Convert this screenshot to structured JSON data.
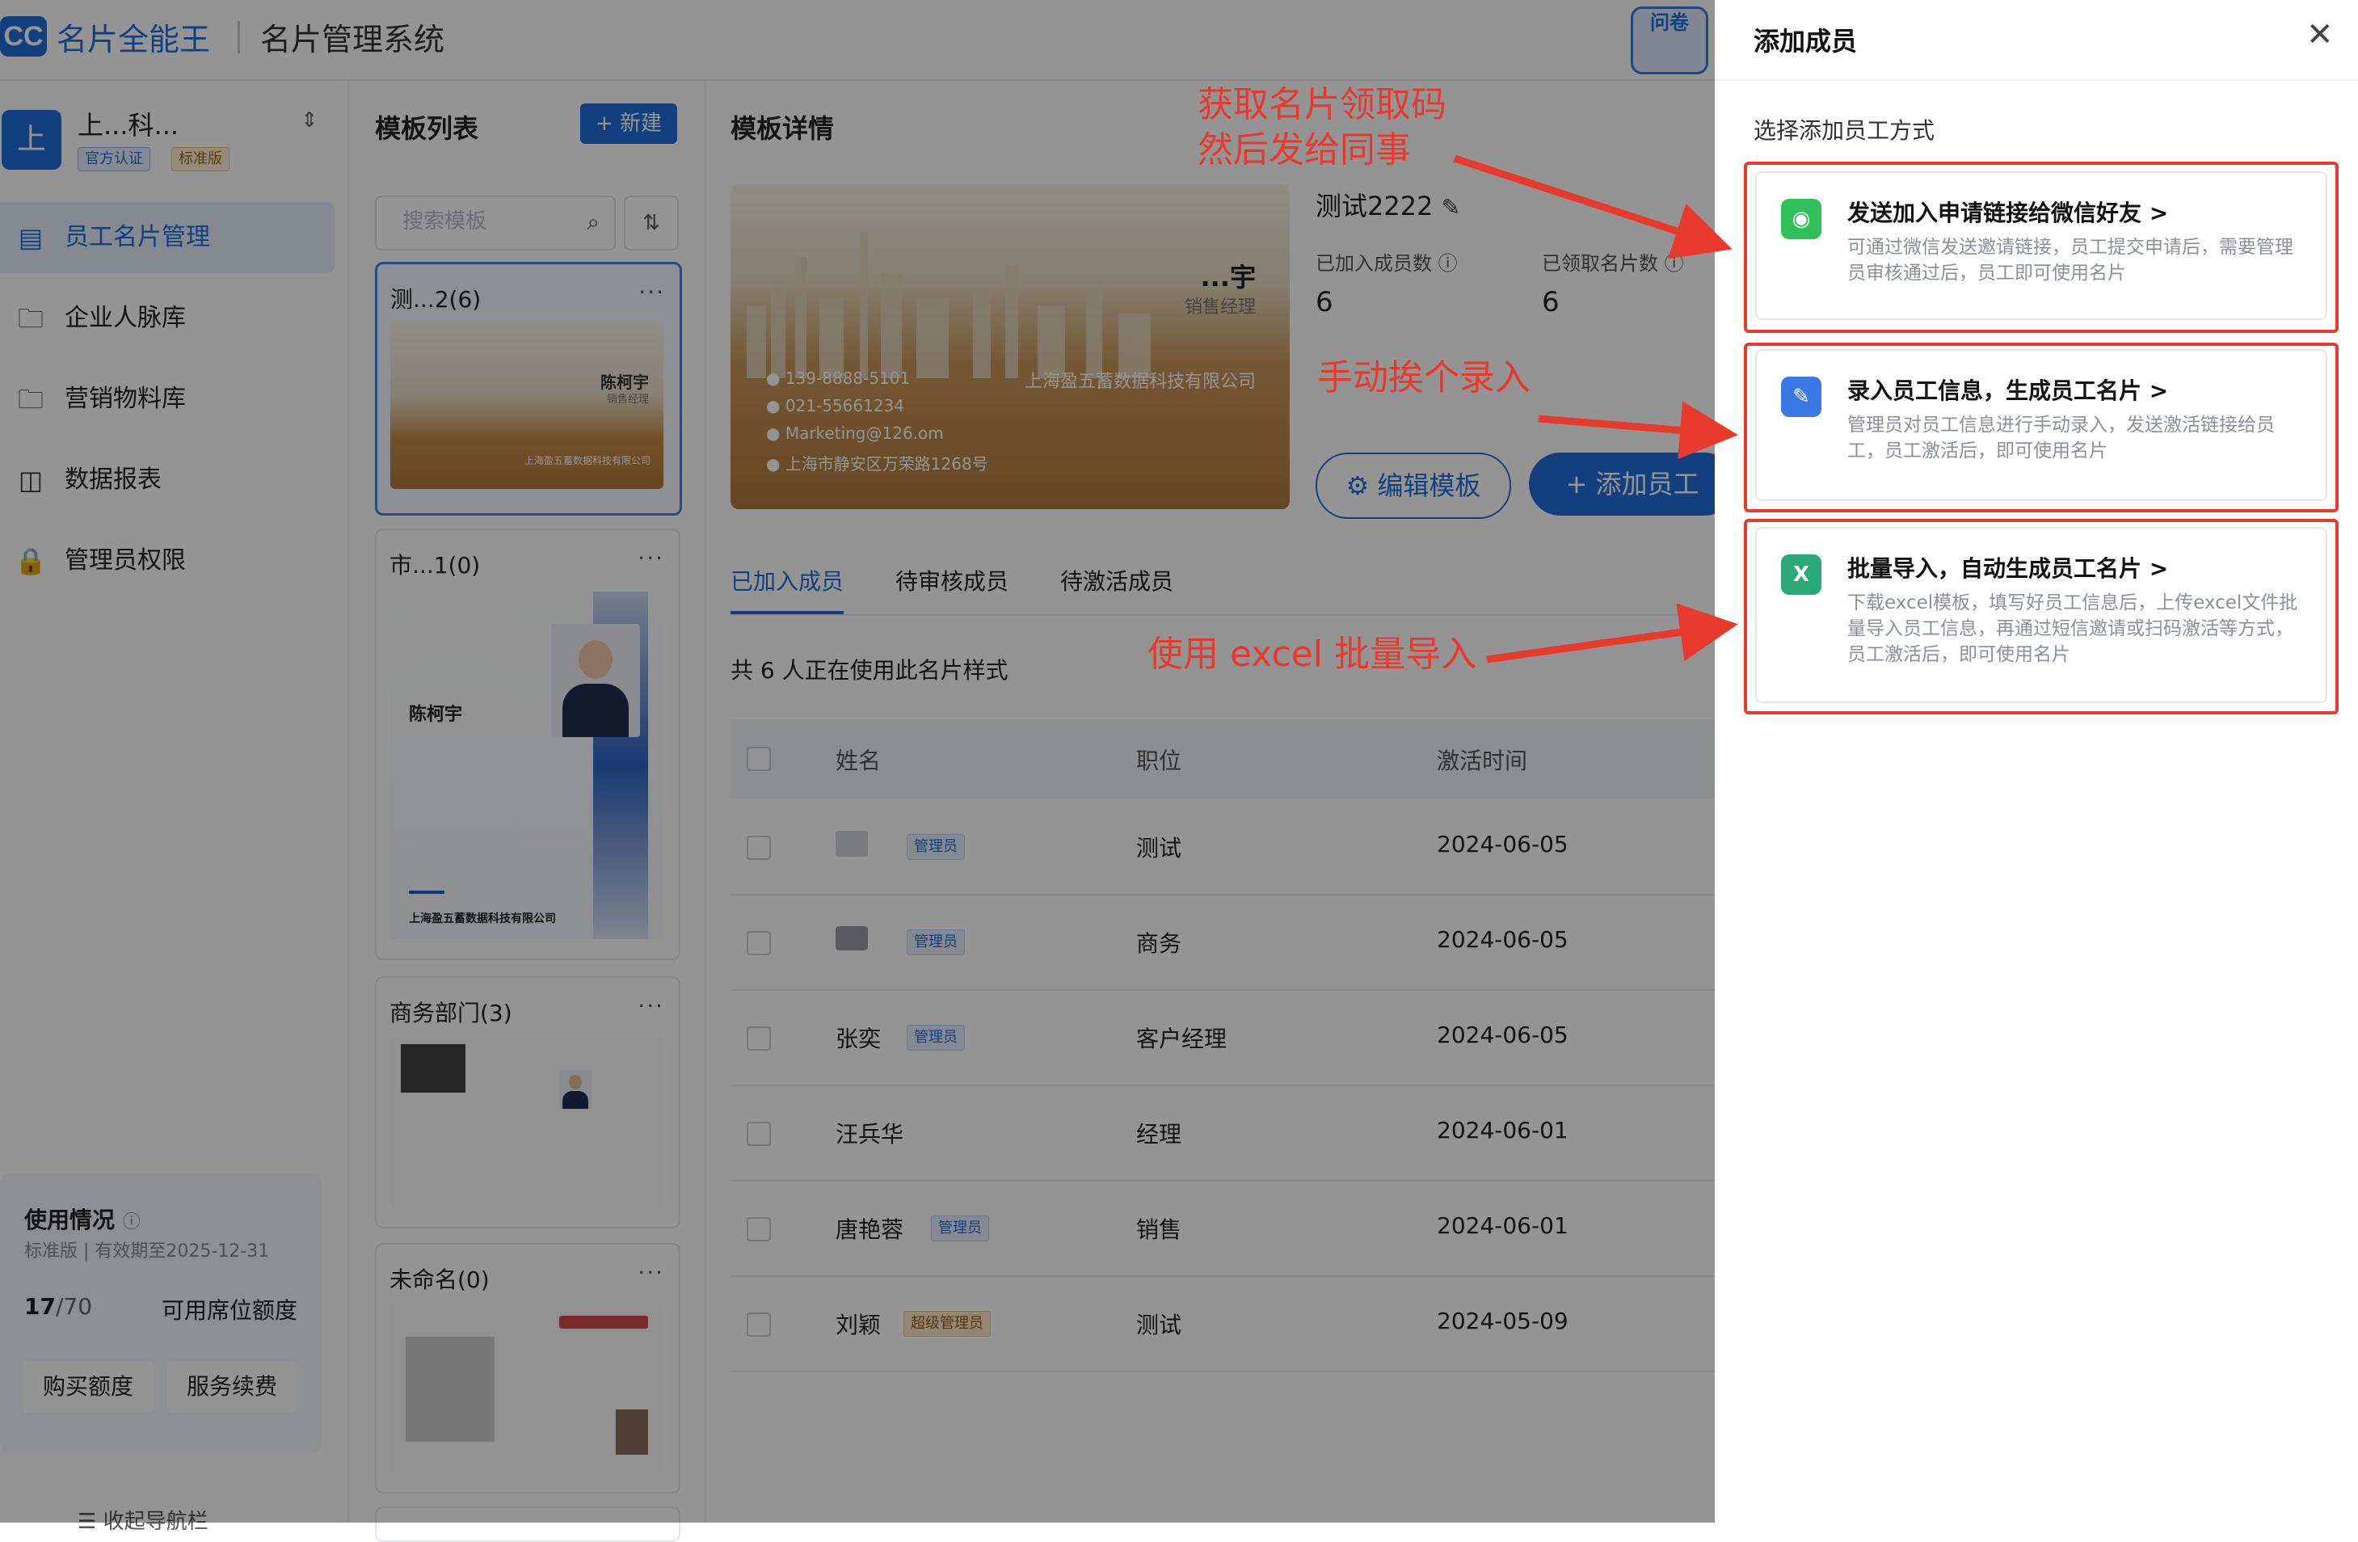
{
  "header": {
    "logo_mark": "CC",
    "brand": "名片全能王",
    "system_title": "名片管理系统",
    "survey_label": "问卷"
  },
  "sidebar": {
    "company_avatar": "上",
    "company_name": "上...科...",
    "badge_official": "官方认证",
    "badge_standard": "标准版",
    "nav": [
      {
        "label": "员工名片管理",
        "icon": "id-card-icon"
      },
      {
        "label": "企业人脉库",
        "icon": "contacts-folder-icon"
      },
      {
        "label": "营销物料库",
        "icon": "folder-icon"
      },
      {
        "label": "数据报表",
        "icon": "chart-icon"
      },
      {
        "label": "管理员权限",
        "icon": "lock-icon"
      }
    ],
    "usage": {
      "title": "使用情况",
      "subtitle": "标准版 | 有效期至2025-12-31",
      "used": "17",
      "total": "/70",
      "label": "可用席位额度",
      "buy": "购买额度",
      "renew": "服务续费"
    },
    "collapse": "收起导航栏"
  },
  "templates": {
    "title": "模板列表",
    "new_label": "+ 新建",
    "search_placeholder": "搜索模板",
    "items": [
      {
        "name": "测...2(6)",
        "person": "陈柯宇",
        "role": "销售经理",
        "company": "上海盈五蓄数据科技有限公司"
      },
      {
        "name": "市...1(0)",
        "person": "陈柯宇",
        "company": "上海盈五蓄数据科技有限公司"
      },
      {
        "name": "商务部门(3)"
      },
      {
        "name": "未命名(0)"
      }
    ]
  },
  "detail": {
    "title": "模板详情",
    "card": {
      "name": "...宇",
      "role": "销售经理",
      "company": "上海盈五蓄数据科技有限公司",
      "phone": "139-8888-5101",
      "tel": "021-55661234",
      "email": "Marketing@126.om",
      "address": "上海市静安区万荣路1268号"
    },
    "template_name": "测试2222",
    "joined_label": "已加入成员数",
    "joined_value": "6",
    "claimed_label": "已领取名片数",
    "claimed_value": "6",
    "edit_btn": "编辑模板",
    "add_btn": "+ 添加员工",
    "tabs": [
      "已加入成员",
      "待审核成员",
      "待激活成员"
    ],
    "summary": "共 6 人正在使用此名片样式",
    "columns": [
      "姓名",
      "职位",
      "激活时间"
    ],
    "rows": [
      {
        "name": "",
        "role_badge": "管理员",
        "title": "测试",
        "date": "2024-06-05"
      },
      {
        "name": "",
        "role_badge": "管理员",
        "title": "商务",
        "date": "2024-06-05"
      },
      {
        "name": "张奕",
        "role_badge": "管理员",
        "title": "客户经理",
        "date": "2024-06-05"
      },
      {
        "name": "汪兵华",
        "role_badge": "",
        "title": "经理",
        "date": "2024-06-01"
      },
      {
        "name": "唐艳蓉",
        "role_badge": "管理员",
        "title": "销售",
        "date": "2024-06-01"
      },
      {
        "name": "刘颖",
        "role_badge": "超级管理员",
        "title": "测试",
        "date": "2024-05-09"
      }
    ]
  },
  "drawer": {
    "title": "添加成员",
    "subtitle": "选择添加员工方式",
    "options": [
      {
        "title": "发送加入申请链接给微信好友 >",
        "desc": "可通过微信发送邀请链接，员工提交申请后，需要管理员审核通过后，员工即可使用名片",
        "icon": "wechat-icon",
        "color": "#2fbf5b"
      },
      {
        "title": "录入员工信息，生成员工名片 >",
        "desc": "管理员对员工信息进行手动录入，发送激活链接给员工，员工激活后，即可使用名片",
        "icon": "edit-icon",
        "color": "#3a78e6"
      },
      {
        "title": "批量导入，自动生成员工名片 >",
        "desc": "下载excel模板，填写好员工信息后，上传excel文件批量导入员工信息，再通过短信邀请或扫码激活等方式，员工激活后，即可使用名片",
        "icon": "excel-icon",
        "color": "#2aa878"
      }
    ]
  },
  "annotations": {
    "a1_line1": "获取名片领取码",
    "a1_line2": "然后发给同事",
    "a2": "手动挨个录入",
    "a3": "使用 excel 批量导入"
  }
}
